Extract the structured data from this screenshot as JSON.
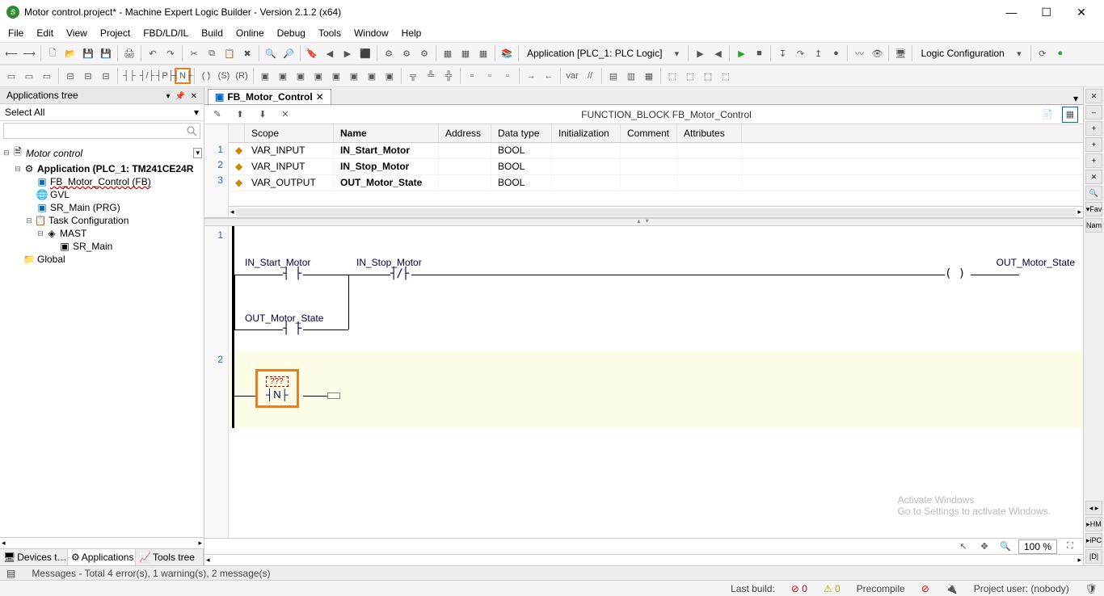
{
  "title": "Motor control.project* - Machine Expert Logic Builder - Version 2.1.2 (x64)",
  "menu": [
    "File",
    "Edit",
    "View",
    "Project",
    "FBD/LD/IL",
    "Build",
    "Online",
    "Debug",
    "Tools",
    "Window",
    "Help"
  ],
  "toolbar_app_label": "Application [PLC_1: PLC Logic]",
  "toolbar_logic_config": "Logic Configuration",
  "sidebar": {
    "title": "Applications tree",
    "selectall": "Select All",
    "tabs": [
      "Devices t…",
      "Applications t…",
      "Tools tree"
    ],
    "tree": {
      "root": "Motor control",
      "app": "Application (PLC_1: TM241CE24R",
      "fb": "FB_Motor_Control (FB)",
      "gvl": "GVL",
      "sr_main": "SR_Main (PRG)",
      "taskcfg": "Task Configuration",
      "mast": "MAST",
      "sr_main2": "SR_Main",
      "global": "Global"
    }
  },
  "editor": {
    "tab": "FB_Motor_Control",
    "decl_title": "FUNCTION_BLOCK FB_Motor_Control",
    "headers": {
      "scope": "Scope",
      "name": "Name",
      "address": "Address",
      "dtype": "Data type",
      "init": "Initialization",
      "comment": "Comment",
      "attr": "Attributes"
    },
    "rows": [
      {
        "scope": "VAR_INPUT",
        "name": "IN_Start_Motor",
        "dtype": "BOOL"
      },
      {
        "scope": "VAR_INPUT",
        "name": "IN_Stop_Motor",
        "dtype": "BOOL"
      },
      {
        "scope": "VAR_OUTPUT",
        "name": "OUT_Motor_State",
        "dtype": "BOOL"
      }
    ],
    "ladder": {
      "r1": {
        "in_start": "IN_Start_Motor",
        "in_stop": "IN_Stop_Motor",
        "out": "OUT_Motor_State",
        "latch": "OUT_Motor_State"
      },
      "r2_placeholder": "???"
    },
    "zoom": "100 %"
  },
  "status": {
    "messages": "Messages - Total 4 error(s), 1 warning(s), 2 message(s)",
    "lastbuild": "Last build:",
    "lb_err": "0",
    "lb_warn": "0",
    "precompile": "Precompile",
    "projuser": "Project user: (nobody)"
  },
  "watermark": {
    "l1": "Activate Windows",
    "l2": "Go to Settings to activate Windows."
  },
  "right_tabs": [
    "✕",
    "–",
    "+",
    "+",
    "+",
    "✕",
    "🔍",
    "▾Fav",
    "Nam",
    " ",
    "◂ ▸",
    "▸HM",
    "▸iPC",
    "|D|"
  ]
}
